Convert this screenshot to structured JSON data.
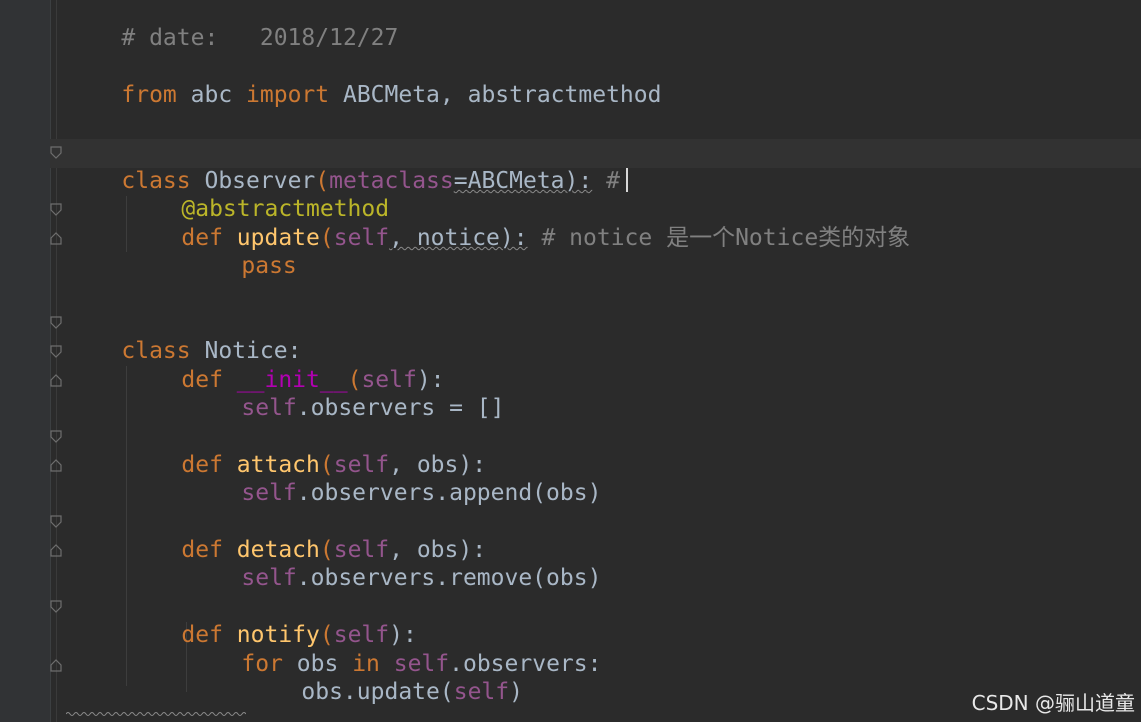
{
  "editor": {
    "language": "python",
    "comment_date": "# date:   2018/12/27",
    "import_from": "from",
    "import_module": " abc ",
    "import_kw": "import",
    "import_names": " ABCMeta, abstractmethod",
    "observer_class_kw": "class",
    "observer_class_name": " Observer",
    "observer_paren_open": "(",
    "observer_metaclass": "metaclass",
    "observer_meta_value": "=ABCMeta):",
    "observer_comment": " #",
    "decorator": "@abstractmethod",
    "update_def": "def",
    "update_name": " update",
    "update_paren": "(",
    "update_self": "self",
    "update_params": ", notice):",
    "update_comment": " # notice 是一个Notice类的对象",
    "pass_kw": "pass",
    "notice_class_kw": "class",
    "notice_class_name": " Notice:",
    "init_def": "def",
    "init_name": "__init__",
    "init_paren": "(",
    "init_self": "self",
    "init_close": "):",
    "init_body_self": "self",
    "init_body_rest": ".observers = []",
    "attach_def": "def",
    "attach_name": " attach",
    "attach_paren": "(",
    "attach_self": "self",
    "attach_params": ", obs):",
    "attach_body_self": "self",
    "attach_body_rest": ".observers.append(obs)",
    "detach_def": "def",
    "detach_name": " detach",
    "detach_paren": "(",
    "detach_self": "self",
    "detach_params": ", obs):",
    "detach_body_self": "self",
    "detach_body_rest": ".observers.remove(obs)",
    "notify_def": "def",
    "notify_name": " notify",
    "notify_paren": "(",
    "notify_self": "self",
    "notify_close": "):",
    "for_kw": "for",
    "for_var": " obs ",
    "in_kw": "in",
    "for_self": " self",
    "for_rest": ".observers:",
    "update_call": "obs.update(",
    "update_call_self": "self",
    "update_call_close": ")"
  },
  "watermark": "CSDN @骊山道童",
  "colors": {
    "background": "#2b2b2b",
    "keyword": "#cc7832",
    "comment": "#808080",
    "decorator": "#bbb529",
    "self": "#94558d",
    "function": "#ffc66d",
    "text": "#a9b7c6"
  }
}
